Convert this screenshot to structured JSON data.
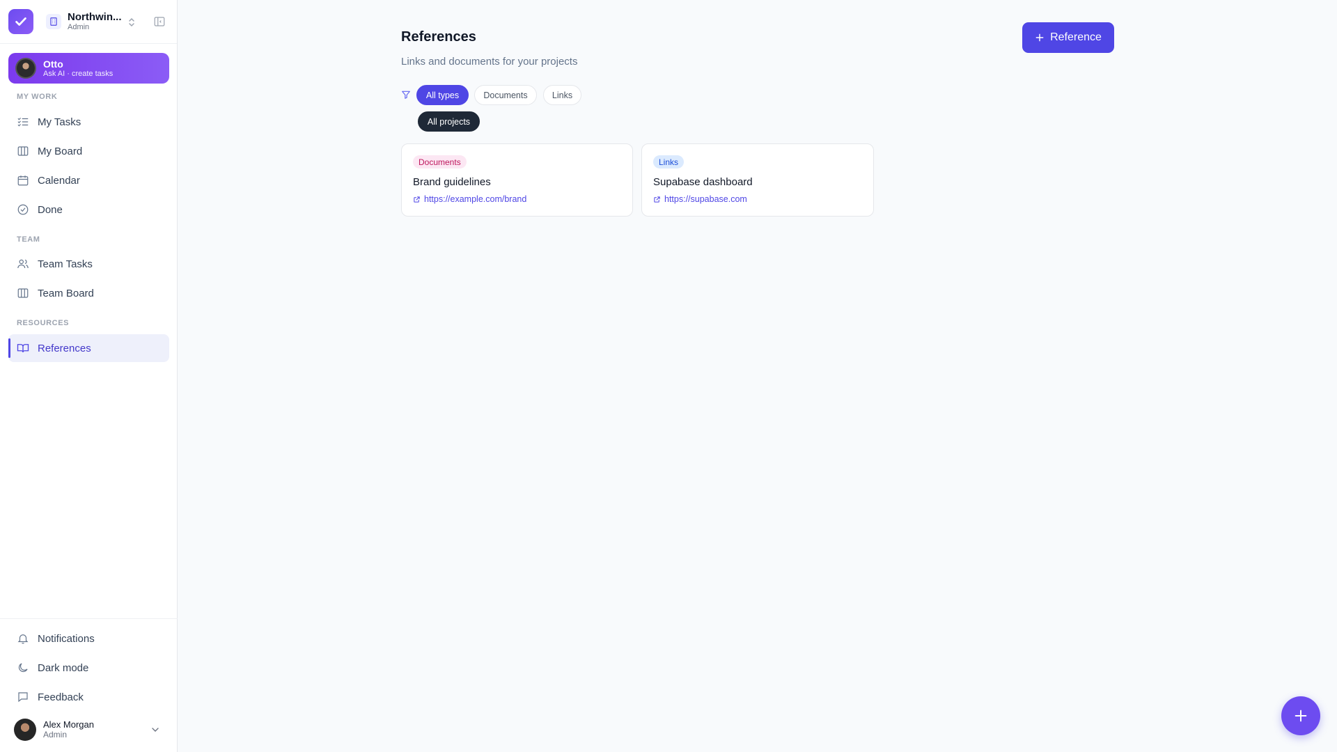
{
  "workspace": {
    "name": "Northwin...",
    "role": "Admin"
  },
  "otto": {
    "name": "Otto",
    "subtitle": "Ask AI · create tasks"
  },
  "sidebar": {
    "sections": {
      "my_work": "MY WORK",
      "team": "TEAM",
      "resources": "RESOURCES"
    },
    "items": {
      "my_tasks": "My Tasks",
      "my_board": "My Board",
      "calendar": "Calendar",
      "done": "Done",
      "team_tasks": "Team Tasks",
      "team_board": "Team Board",
      "references": "References"
    },
    "footer": {
      "notifications": "Notifications",
      "dark_mode": "Dark mode",
      "feedback": "Feedback"
    },
    "user": {
      "name": "Alex Morgan",
      "role": "Admin"
    }
  },
  "main": {
    "title": "References",
    "subtitle": "Links and documents for your projects",
    "add_button": "Reference",
    "filters": {
      "types": [
        "All types",
        "Documents",
        "Links"
      ],
      "active_type": "All types",
      "project": "All projects"
    },
    "cards": [
      {
        "type": "Documents",
        "title": "Brand guidelines",
        "url": "https://example.com/brand"
      },
      {
        "type": "Links",
        "title": "Supabase dashboard",
        "url": "https://supabase.com"
      }
    ]
  },
  "colors": {
    "accent": "#4f46e5",
    "otto_gradient": "#7c3aed",
    "doc_badge": "#be185d",
    "link_badge": "#1d4ed8"
  }
}
